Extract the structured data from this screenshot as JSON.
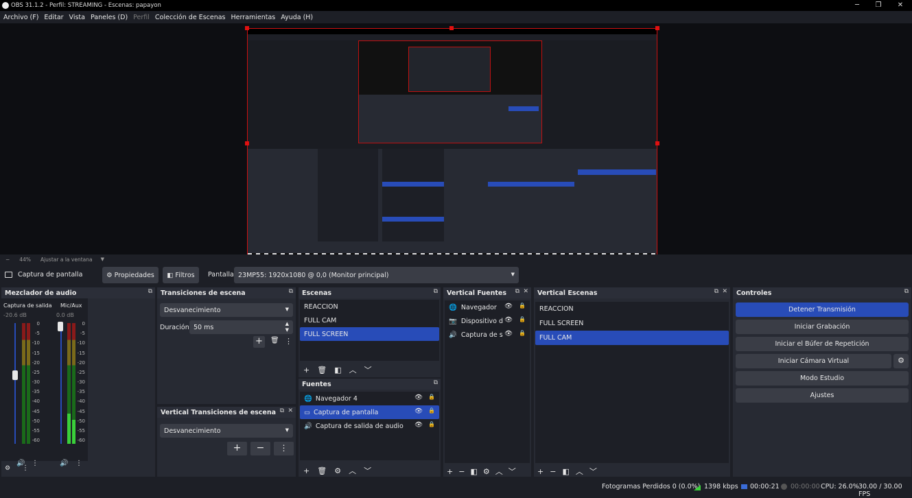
{
  "window": {
    "title": "OBS 31.1.2 - Perfil: STREAMING - Escenas: papayon",
    "minimize": "─",
    "restore": "❐",
    "close": "✕"
  },
  "menu": [
    "Archivo (F)",
    "Editar",
    "Vista",
    "Paneles (D)",
    "Perfil",
    "Colección de Escenas",
    "Herramientas",
    "Ayuda (H)"
  ],
  "zoom": {
    "minus": "−",
    "level": "44%",
    "fit_label": "Ajustar a la ventana"
  },
  "source_bar": {
    "source_name": "Captura de pantalla",
    "properties_label": "Propiedades",
    "filters_label": "Filtros",
    "display_label": "Pantalla",
    "display_value": "23MP55: 1920x1080 @ 0,0 (Monitor principal)"
  },
  "audio_mixer": {
    "title": "Mezclador de audio",
    "channels": [
      {
        "name": "Captura de salida d",
        "db": "-20.6 dB",
        "fader_level": 0.6
      },
      {
        "name": "Mic/Aux",
        "db": "0.0 dB",
        "fader_level": 1.0
      }
    ],
    "scale": [
      "0",
      "-5",
      "-10",
      "-15",
      "-20",
      "-25",
      "-30",
      "-35",
      "-40",
      "-45",
      "-50",
      "-55",
      "-60"
    ]
  },
  "transitions": {
    "title": "Transiciones de escena",
    "selected": "Desvanecimiento",
    "duration_label": "Duración",
    "duration_value": "50 ms"
  },
  "vertical_transitions": {
    "title": "Vertical Transiciones de escena",
    "selected": "Desvanecimiento"
  },
  "scenes": {
    "title": "Escenas",
    "items": [
      "REACCION",
      "FULL CAM",
      "FULL SCREEN"
    ],
    "selected_index": 2
  },
  "sources": {
    "title": "Fuentes",
    "items": [
      "Navegador 4",
      "Captura de pantalla",
      "Captura de salida de audio"
    ],
    "selected_index": 1
  },
  "vertical_sources": {
    "title": "Vertical Fuentes",
    "items": [
      "Navegador",
      "Dispositivo d",
      "Captura de s"
    ]
  },
  "vertical_scenes": {
    "title": "Vertical Escenas",
    "items": [
      "REACCION",
      "FULL SCREEN",
      "FULL CAM"
    ],
    "selected_index": 2
  },
  "controls": {
    "title": "Controles",
    "buttons": [
      "Detener Transmisión",
      "Iniciar Grabación",
      "Iniciar el Búfer de Repetición",
      "Iniciar Cámara Virtual",
      "Modo Estudio",
      "Ajustes"
    ]
  },
  "status": {
    "dropped_frames": "Fotogramas Perdidos 0 (0.0%)",
    "bitrate": "1398 kbps",
    "stream_time": "00:00:21",
    "record_time": "00:00:00",
    "cpu": "CPU: 26.0%",
    "fps": "30.00 / 30.00 FPS"
  },
  "colors": {
    "accent": "#284cb8",
    "panel": "#272a33",
    "background": "#1d1f26",
    "button": "#3a3d46"
  }
}
